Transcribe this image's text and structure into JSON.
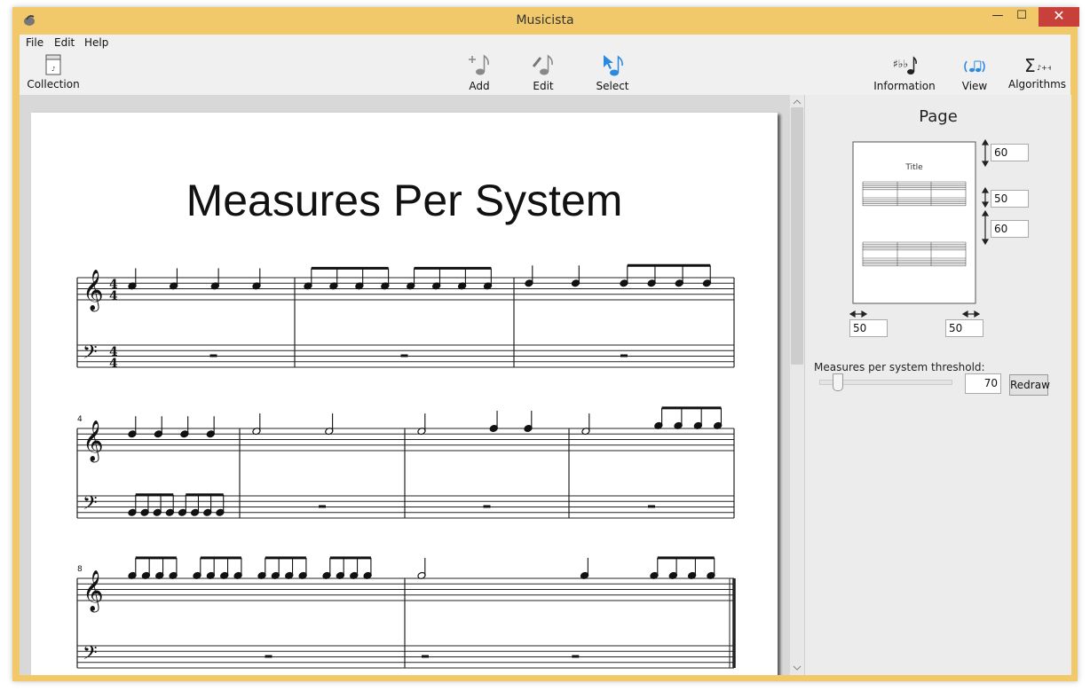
{
  "window": {
    "title": "Musicista",
    "minimize_glyph": "—",
    "maximize_glyph": "☐",
    "close_glyph": "✕"
  },
  "menu": {
    "file": "File",
    "edit": "Edit",
    "help": "Help"
  },
  "toolbar": {
    "collection": "Collection",
    "add": "Add",
    "edit": "Edit",
    "select": "Select",
    "information": "Information",
    "view": "View",
    "algorithms": "Algorithms"
  },
  "score": {
    "title": "Measures Per System",
    "measure_numbers": [
      "4",
      "8"
    ],
    "time_signature": {
      "top": "4",
      "bottom": "4"
    }
  },
  "panel": {
    "title": "Page",
    "preview_title": "Title",
    "margin_top": "60",
    "system_spacing": "50",
    "bottom_gap": "60",
    "margin_left": "50",
    "margin_right": "50",
    "threshold_label": "Measures per system threshold:",
    "threshold_value": "70",
    "threshold_fraction": 0.1,
    "redraw_label": "Redraw"
  },
  "colors": {
    "window_frame": "#f1c96a",
    "close_button": "#c7403a",
    "select_accent": "#2a8ae0"
  }
}
